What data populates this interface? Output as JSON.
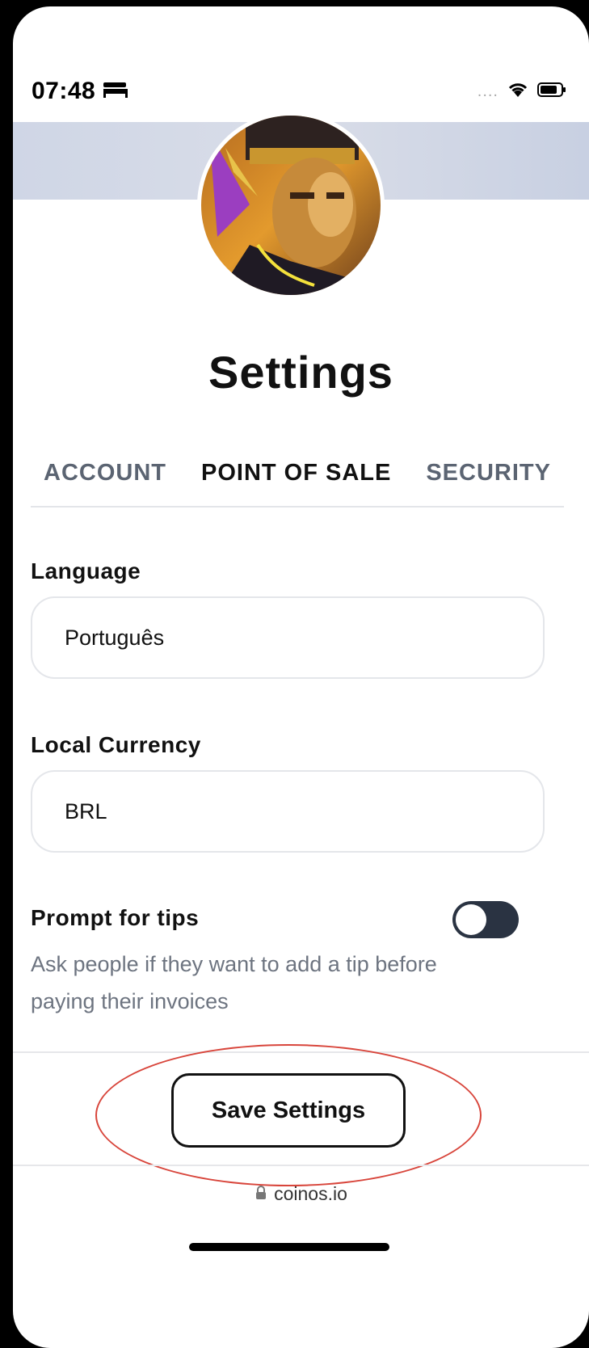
{
  "status_bar": {
    "time": "07:48",
    "signal": "....",
    "icons": [
      "bed-icon",
      "wifi-icon",
      "battery-icon"
    ]
  },
  "page": {
    "title": "Settings"
  },
  "tabs": [
    {
      "label": "ACCOUNT",
      "active": false
    },
    {
      "label": "POINT OF SALE",
      "active": true
    },
    {
      "label": "SECURITY",
      "active": false
    }
  ],
  "language": {
    "label": "Language",
    "value": "Português"
  },
  "currency": {
    "label": "Local Currency",
    "value": "BRL"
  },
  "tips": {
    "label": "Prompt for tips",
    "description": "Ask people if they want to add a tip before paying their invoices",
    "enabled": false
  },
  "actions": {
    "save_label": "Save Settings"
  },
  "browser": {
    "url": "coinos.io"
  },
  "colors": {
    "accent_dark": "#2a3342",
    "annotation_red": "#d8453b",
    "banner": "#d3d9e6"
  }
}
